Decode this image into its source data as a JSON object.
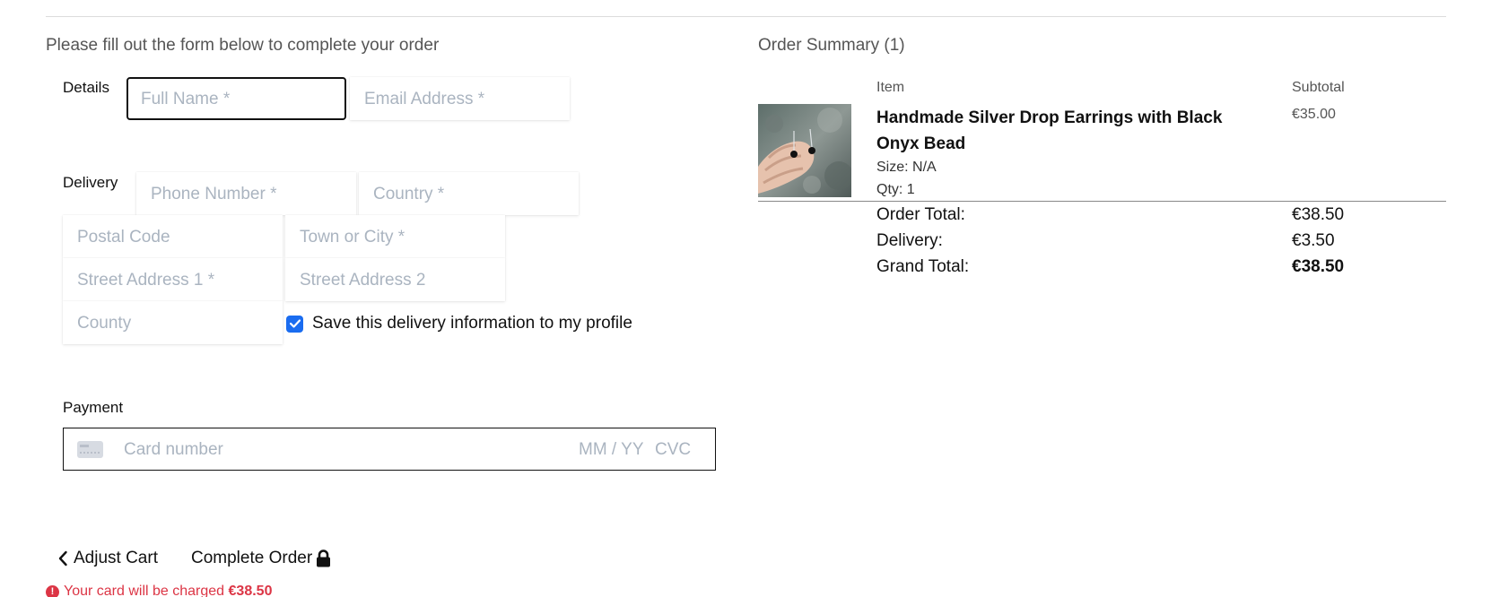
{
  "intro_text": "Please fill out the form below to complete your order",
  "details": {
    "label": "Details",
    "full_name_placeholder": "Full Name *",
    "email_placeholder": "Email Address *"
  },
  "delivery": {
    "label": "Delivery",
    "phone_placeholder": "Phone Number *",
    "country_placeholder": "Country *",
    "postal_placeholder": "Postal Code",
    "town_placeholder": "Town or City *",
    "street1_placeholder": "Street Address 1 *",
    "street2_placeholder": "Street Address 2",
    "county_placeholder": "County",
    "save_info_label": "Save this delivery information to my profile",
    "save_info_checked": true
  },
  "payment": {
    "label": "Payment",
    "card_number_placeholder": "Card number",
    "expiry_placeholder": "MM / YY",
    "cvc_placeholder": "CVC"
  },
  "actions": {
    "adjust_cart_label": "Adjust Cart",
    "complete_order_label": "Complete Order"
  },
  "charge_notice": {
    "text": "Your card will be charged",
    "amount": "€38.50"
  },
  "summary": {
    "title": "Order Summary (1)",
    "item_header": "Item",
    "subtotal_header": "Subtotal",
    "item": {
      "name": "Handmade Silver Drop Earrings with Black Onyx Bead",
      "size": "Size: N/A",
      "qty": "Qty: 1",
      "subtotal": "€35.00"
    },
    "order_total_label": "Order Total:",
    "order_total_value": "€38.50",
    "delivery_label": "Delivery:",
    "delivery_value": "€3.50",
    "grand_total_label": "Grand Total:",
    "grand_total_value": "€38.50"
  },
  "colors": {
    "accent": "#1a6cf0",
    "danger": "#dc3545",
    "placeholder": "#aab4c0"
  }
}
